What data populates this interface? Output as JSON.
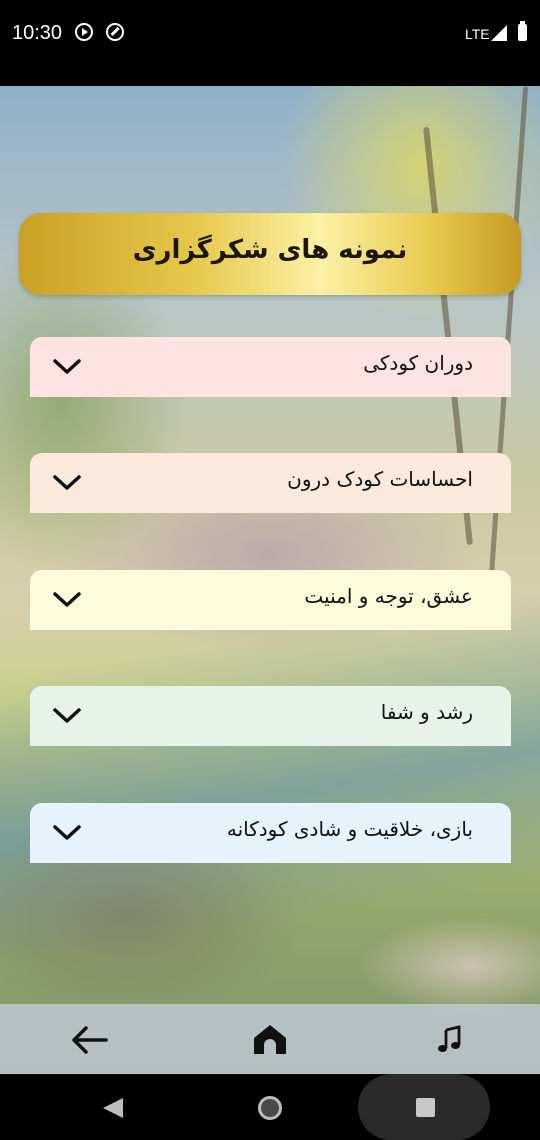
{
  "status_bar": {
    "time": "10:30",
    "network": "LTE",
    "icons": [
      "play-icon",
      "blocked-icon",
      "signal-icon",
      "battery-icon"
    ]
  },
  "header": {
    "title": "نمونه های شکرگزاری"
  },
  "sections": [
    {
      "label": "دوران کودکی",
      "color": "#fde4e2"
    },
    {
      "label": "احساسات کودک درون",
      "color": "#fbe9dc"
    },
    {
      "label": "عشق، توجه و امنیت",
      "color": "#fdfbdc"
    },
    {
      "label": "رشد و شفا",
      "color": "#e7f3e8"
    },
    {
      "label": "بازی، خلاقیت و شادی کودکانه",
      "color": "#e6f3fb"
    }
  ],
  "bottom_nav": {
    "icons": [
      "back-arrow-icon",
      "home-icon",
      "music-note-icon"
    ]
  },
  "system_nav": {
    "icons": [
      "back-icon",
      "home-icon",
      "recents-icon"
    ]
  }
}
